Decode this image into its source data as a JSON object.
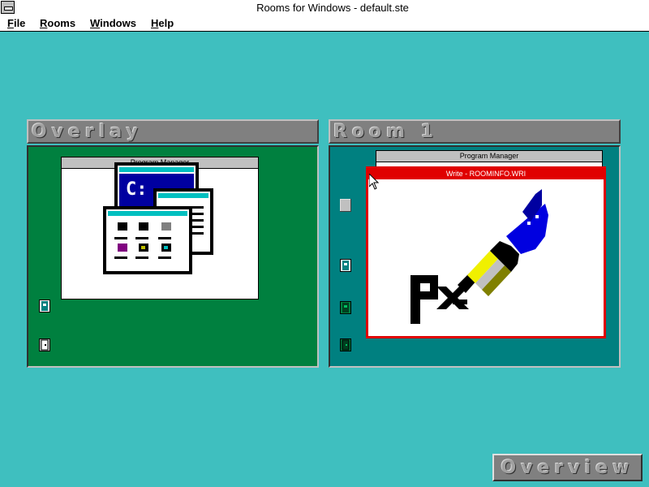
{
  "window": {
    "title": "Rooms for Windows - default.ste"
  },
  "menu": {
    "items": [
      "File",
      "Rooms",
      "Windows",
      "Help"
    ]
  },
  "rooms": [
    {
      "name": "Overlay",
      "background": "#00803f",
      "windows": [
        {
          "title": "Program Manager",
          "icon": "program-manager-icon"
        }
      ],
      "doors": [
        "door-icon",
        "back-door-icon"
      ]
    },
    {
      "name": "Room 1",
      "background": "#008080",
      "windows": [
        {
          "title": "Program Manager"
        },
        {
          "title": "Write - ROOMINFO.WRI",
          "icon": "write-pen-icon",
          "active": true
        }
      ],
      "doors": [
        "door-gray-icon",
        "door-icon",
        "door-green-icon",
        "back-door-icon"
      ]
    }
  ],
  "overview": {
    "label": "Overview"
  },
  "colors": {
    "desktop": "#3fbfbf",
    "active_title": "#e00000"
  }
}
